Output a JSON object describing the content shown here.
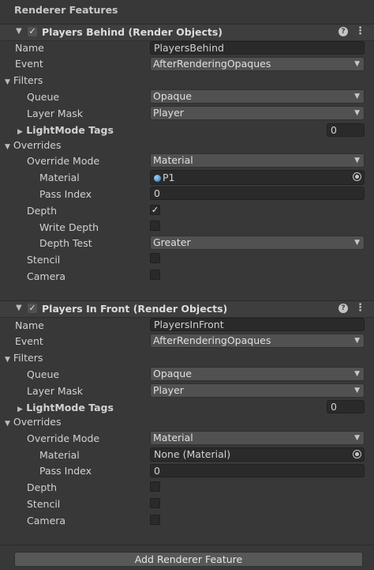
{
  "title": "Renderer Features",
  "features": [
    {
      "header": "Players Behind (Render Objects)",
      "name": "PlayersBehind",
      "event": "AfterRenderingOpaques",
      "queue": "Opaque",
      "layer_mask": "Player",
      "lightmode_tags_count": "0",
      "override_mode": "Material",
      "material": "P1",
      "pass_index": "0",
      "depth_checked": "✓",
      "depth_test": "Greater"
    },
    {
      "header": "Players In Front (Render Objects)",
      "name": "PlayersInFront",
      "event": "AfterRenderingOpaques",
      "queue": "Opaque",
      "layer_mask": "Player",
      "lightmode_tags_count": "0",
      "override_mode": "Material",
      "material": "None (Material)",
      "pass_index": "0"
    }
  ],
  "labels": {
    "name": "Name",
    "event": "Event",
    "filters": "Filters",
    "queue": "Queue",
    "layer_mask": "Layer Mask",
    "lightmode_tags": "LightMode Tags",
    "overrides": "Overrides",
    "override_mode": "Override Mode",
    "material": "Material",
    "pass_index": "Pass Index",
    "depth": "Depth",
    "write_depth": "Write Depth",
    "depth_test": "Depth Test",
    "stencil": "Stencil",
    "camera": "Camera"
  },
  "icons": {
    "foldout_open": "▼",
    "foldout_closed": "▶",
    "dropdown": "▼",
    "check": "✓",
    "help": "?",
    "menu": "⋮"
  },
  "add_button": "Add Renderer Feature"
}
